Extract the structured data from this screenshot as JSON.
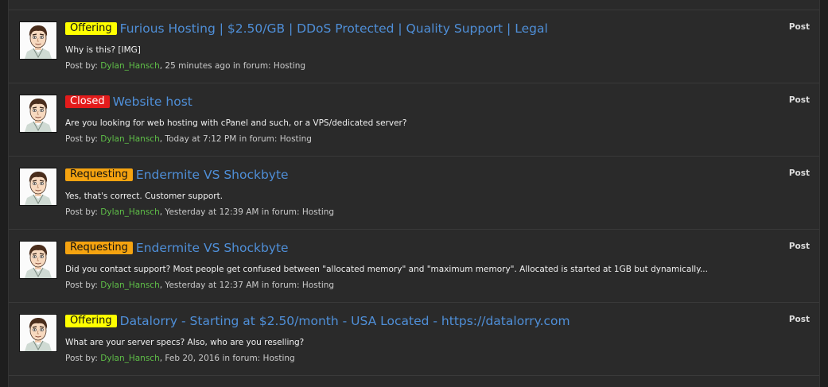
{
  "colors": {
    "offering": "#ffff00",
    "closed": "#e31b1b",
    "requesting": "#f5a310",
    "title_link": "#4f8fd8",
    "username": "#5fbf48"
  },
  "results": [
    {
      "prefix": "Offering",
      "prefix_color": "#ffff00",
      "prefix_text_color": "#111111",
      "title": "Furious Hosting | $2.50/GB | DDoS Protected | Quality Support | Legal",
      "snippet": "Why is this? [IMG]",
      "meta_prefix": "Post by: ",
      "user": "Dylan_Hansch",
      "meta_suffix": ", 25 minutes ago in forum: Hosting",
      "type": "Post"
    },
    {
      "prefix": "Closed",
      "prefix_color": "#e31b1b",
      "prefix_text_color": "#ffffff",
      "title": "Website host",
      "snippet": "Are you looking for web hosting with cPanel and such, or a VPS/dedicated server?",
      "meta_prefix": "Post by: ",
      "user": "Dylan_Hansch",
      "meta_suffix": ", Today at 7:12 PM in forum: Hosting",
      "type": "Post"
    },
    {
      "prefix": "Requesting",
      "prefix_color": "#f5a310",
      "prefix_text_color": "#111111",
      "title": "Endermite VS Shockbyte",
      "snippet": "Yes, that's correct. Customer support.",
      "meta_prefix": "Post by: ",
      "user": "Dylan_Hansch",
      "meta_suffix": ", Yesterday at 12:39 AM in forum: Hosting",
      "type": "Post"
    },
    {
      "prefix": "Requesting",
      "prefix_color": "#f5a310",
      "prefix_text_color": "#111111",
      "title": "Endermite VS Shockbyte",
      "snippet": "Did you contact support? Most people get confused between \"allocated memory\" and \"maximum memory\". Allocated is started at 1GB but dynamically...",
      "meta_prefix": "Post by: ",
      "user": "Dylan_Hansch",
      "meta_suffix": ", Yesterday at 12:37 AM in forum: Hosting",
      "type": "Post"
    },
    {
      "prefix": "Offering",
      "prefix_color": "#ffff00",
      "prefix_text_color": "#111111",
      "title": "Datalorry - Starting at $2.50/month - USA Located - https://datalorry.com",
      "snippet": "What are your server specs? Also, who are you reselling?",
      "meta_prefix": "Post by: ",
      "user": "Dylan_Hansch",
      "meta_suffix": ", Feb 20, 2016 in forum: Hosting",
      "type": "Post"
    }
  ]
}
